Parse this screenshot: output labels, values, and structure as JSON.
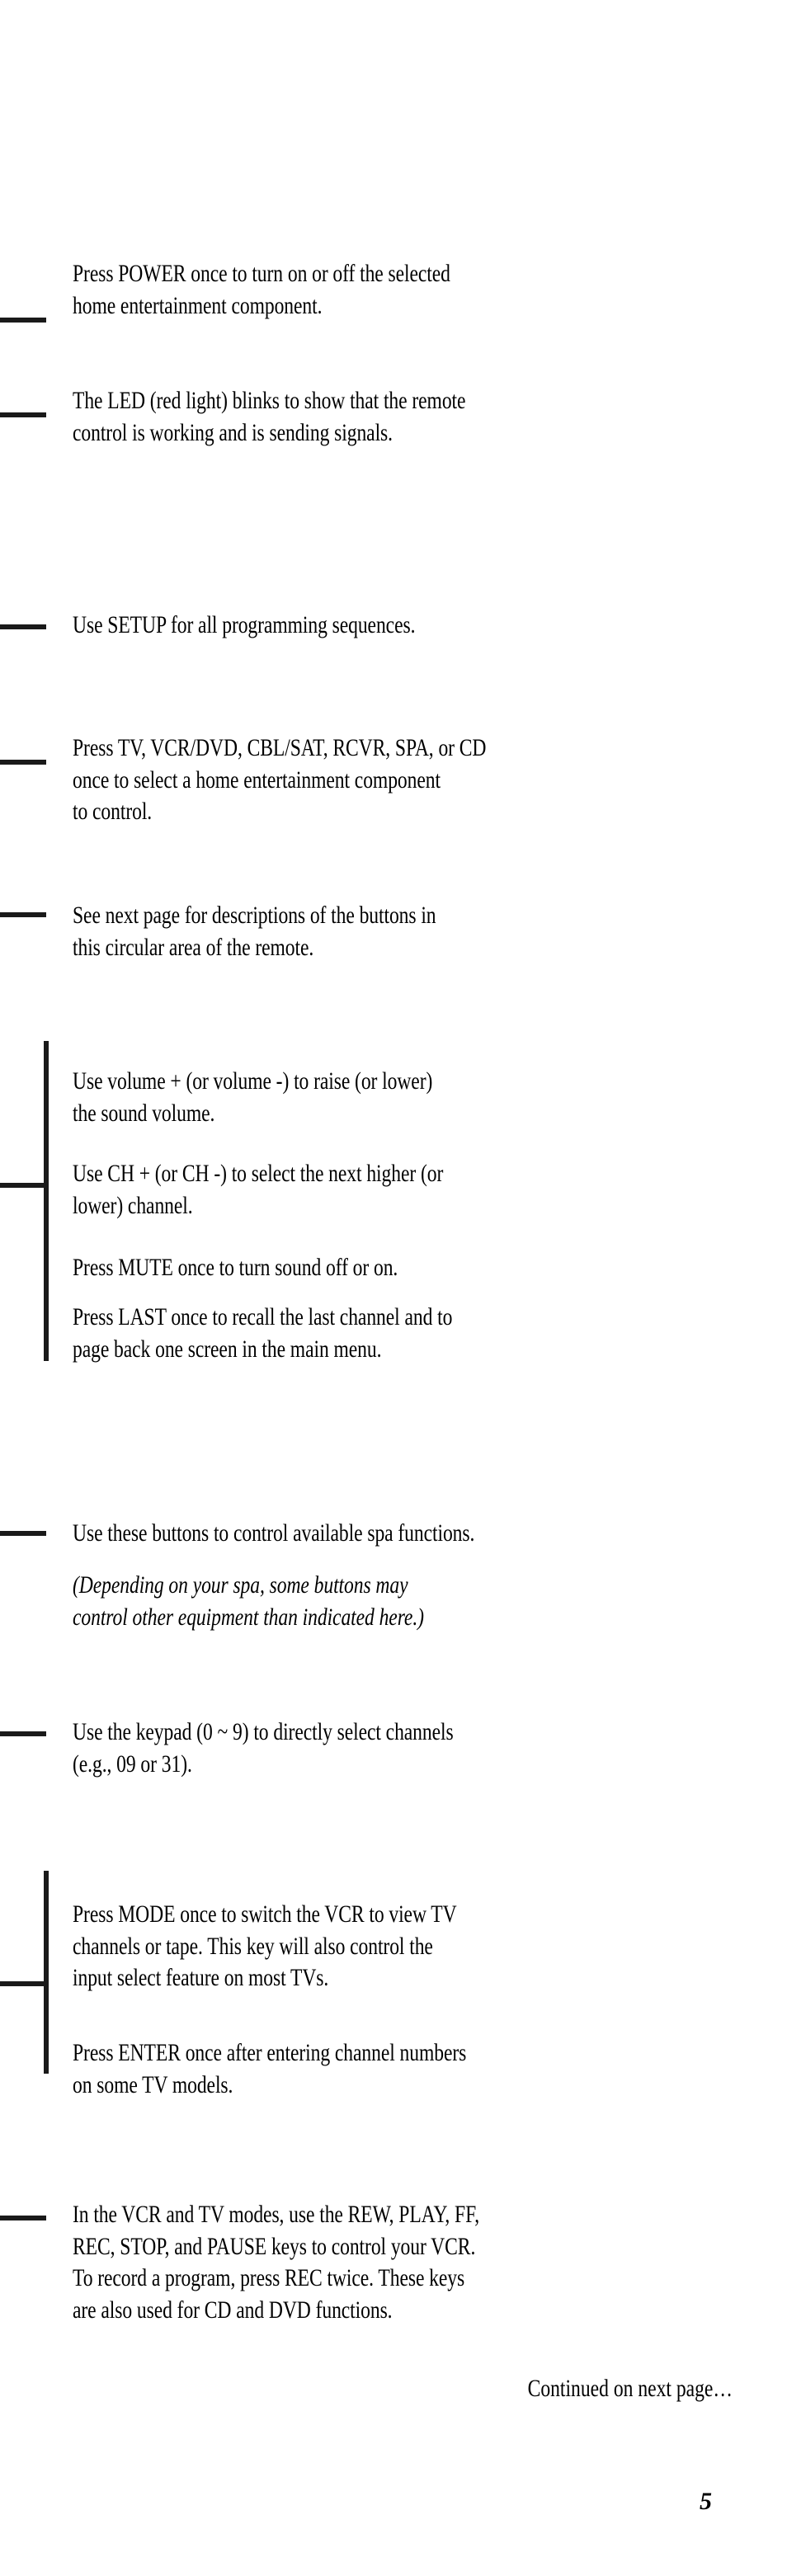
{
  "page": {
    "number": "5",
    "background_color": "#ffffff",
    "ink_color": "#1a1a1a"
  },
  "callouts": [
    {
      "id": "power",
      "marker": "dash",
      "text": "Press POWER once to turn on or off the selected\nhome entertainment component."
    },
    {
      "id": "led",
      "marker": "dash",
      "text": "The LED (red light) blinks to show that the remote\ncontrol is working and is sending signals."
    },
    {
      "id": "setup",
      "marker": "dash",
      "text": "Use SETUP for all programming sequences."
    },
    {
      "id": "component-select",
      "marker": "dash",
      "text": "Press TV, VCR/DVD, CBL/SAT, RCVR, SPA, or CD\nonce to select a home entertainment component\nto control."
    },
    {
      "id": "circular-area",
      "marker": "dash",
      "text": "See next page for descriptions of the buttons in\nthis circular area of the remote."
    },
    {
      "id": "volume",
      "marker": "bracket",
      "text": "Use volume + (or volume -) to raise (or lower)\nthe sound volume."
    },
    {
      "id": "channel",
      "marker": "bracket",
      "text": "Use CH + (or CH -) to select the next higher (or\nlower) channel."
    },
    {
      "id": "mute",
      "marker": "bracket",
      "text": "Press MUTE once to turn sound off or on."
    },
    {
      "id": "last",
      "marker": "bracket",
      "text": "Press LAST once to recall the last channel and to\npage back one screen in the main menu."
    },
    {
      "id": "spa-functions",
      "marker": "dash",
      "text": "Use these buttons to control available spa functions."
    },
    {
      "id": "spa-note",
      "marker": "none",
      "style": "italic",
      "text": "(Depending on your spa, some buttons may\ncontrol other equipment than indicated here.)"
    },
    {
      "id": "keypad",
      "marker": "dash",
      "text": "Use the keypad (0 ~ 9) to directly select channels\n(e.g., 09 or 31)."
    },
    {
      "id": "mode",
      "marker": "bracket",
      "text": "Press MODE once to switch the VCR to view TV\nchannels or tape. This key will also control the\ninput select feature on most TVs."
    },
    {
      "id": "enter",
      "marker": "bracket",
      "text": "Press ENTER once after entering channel numbers\non some TV models."
    },
    {
      "id": "transport",
      "marker": "dash",
      "text": "In the VCR and TV modes, use the REW, PLAY, FF,\nREC, STOP, and PAUSE keys to control your VCR.\nTo record a program, press REC twice. These keys\nare also used for CD and DVD functions."
    }
  ],
  "footer": {
    "continued_label": "Continued on next page…"
  }
}
